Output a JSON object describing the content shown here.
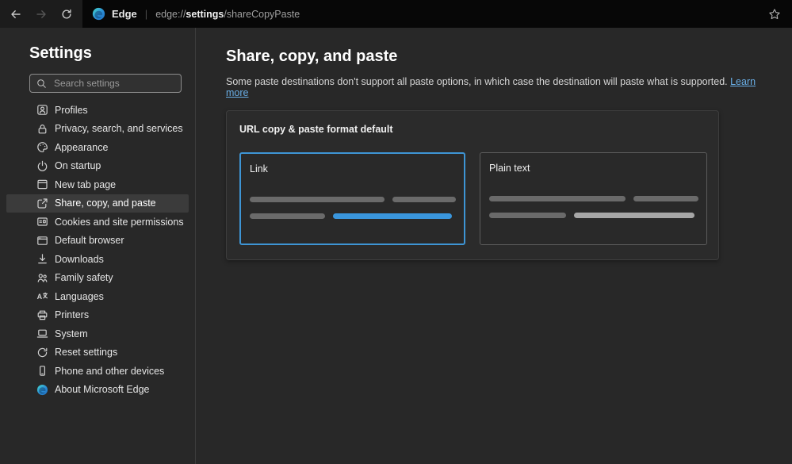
{
  "browser": {
    "app_label": "Edge",
    "url": {
      "prefix": "edge://",
      "highlight": "settings",
      "suffix": "/shareCopyPaste"
    }
  },
  "sidebar": {
    "title": "Settings",
    "search_placeholder": "Search settings",
    "items": [
      {
        "label": "Profiles",
        "selected": false
      },
      {
        "label": "Privacy, search, and services",
        "selected": false
      },
      {
        "label": "Appearance",
        "selected": false
      },
      {
        "label": "On startup",
        "selected": false
      },
      {
        "label": "New tab page",
        "selected": false
      },
      {
        "label": "Share, copy, and paste",
        "selected": true
      },
      {
        "label": "Cookies and site permissions",
        "selected": false
      },
      {
        "label": "Default browser",
        "selected": false
      },
      {
        "label": "Downloads",
        "selected": false
      },
      {
        "label": "Family safety",
        "selected": false
      },
      {
        "label": "Languages",
        "selected": false
      },
      {
        "label": "Printers",
        "selected": false
      },
      {
        "label": "System",
        "selected": false
      },
      {
        "label": "Reset settings",
        "selected": false
      },
      {
        "label": "Phone and other devices",
        "selected": false
      },
      {
        "label": "About Microsoft Edge",
        "selected": false
      }
    ]
  },
  "main": {
    "title": "Share, copy, and paste",
    "description": "Some paste destinations don't support all paste options, in which case the destination will paste what is supported.",
    "learn_more": "Learn more",
    "card": {
      "title": "URL copy & paste format default",
      "options": [
        {
          "label": "Link",
          "selected": true
        },
        {
          "label": "Plain text",
          "selected": false
        }
      ]
    }
  },
  "colors": {
    "accent_tile_border": "#3e95d5",
    "accent_skeleton_bar": "#3a96dd",
    "link": "#69aee6",
    "page_background": "#282828",
    "topbar_background": "#1c1c1c",
    "addressbar_background": "#070707"
  }
}
